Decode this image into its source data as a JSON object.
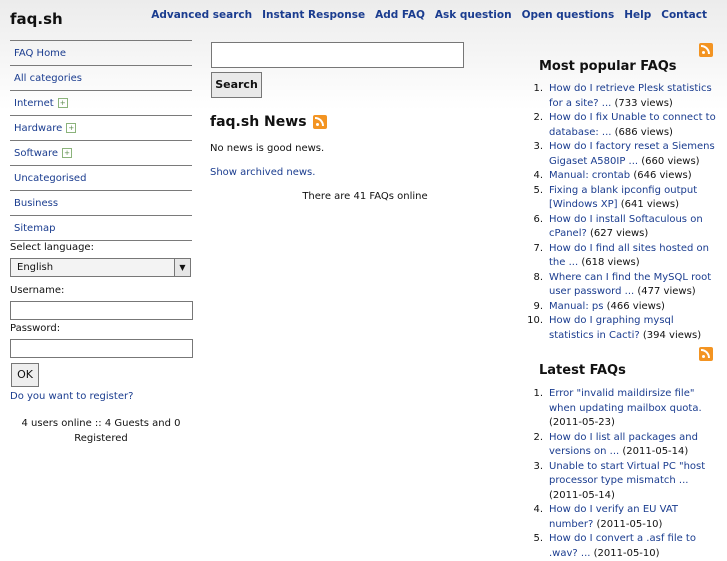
{
  "site": {
    "title": "faq.sh"
  },
  "topnav": [
    "Advanced search",
    "Instant Response",
    "Add FAQ",
    "Ask question",
    "Open questions",
    "Help",
    "Contact"
  ],
  "sidebar": {
    "items": [
      {
        "label": "FAQ Home",
        "expandable": false
      },
      {
        "label": "All categories",
        "expandable": false
      },
      {
        "label": "Internet",
        "expandable": true
      },
      {
        "label": "Hardware",
        "expandable": true
      },
      {
        "label": "Software",
        "expandable": true
      },
      {
        "label": "Uncategorised",
        "expandable": false
      },
      {
        "label": "Business",
        "expandable": false
      },
      {
        "label": "Sitemap",
        "expandable": false
      }
    ],
    "language_label": "Select language:",
    "language_value": "English",
    "username_label": "Username:",
    "password_label": "Password:",
    "ok_label": "OK",
    "register_link": "Do you want to register?",
    "online_text": "4 users online :: 4 Guests and 0 Registered"
  },
  "main": {
    "search_button": "Search",
    "news_title": "faq.sh News",
    "news_empty": "No news is good news.",
    "archived_link": "Show archived news.",
    "faqs_online": "There are 41 FAQs online"
  },
  "popular": {
    "title": "Most popular FAQs",
    "items": [
      {
        "link": "How do I retrieve Plesk statistics for a site? ...",
        "meta": "(733 views)"
      },
      {
        "link": "How do I fix Unable to connect to database: ...",
        "meta": "(686 views)"
      },
      {
        "link": "How do I factory reset a Siemens Gigaset A580IP ...",
        "meta": "(660 views)"
      },
      {
        "link": "Manual: crontab",
        "meta": "(646 views)"
      },
      {
        "link": "Fixing a blank ipconfig output [Windows XP]",
        "meta": "(641 views)"
      },
      {
        "link": "How do I install Softaculous on cPanel?",
        "meta": "(627 views)"
      },
      {
        "link": "How do I find all sites hosted on the ...",
        "meta": "(618 views)"
      },
      {
        "link": "Where can I find the MySQL root user password ...",
        "meta": "(477 views)"
      },
      {
        "link": "Manual: ps",
        "meta": "(466 views)"
      },
      {
        "link": "How do I graphing mysql statistics in Cacti?",
        "meta": "(394 views)"
      }
    ]
  },
  "latest": {
    "title": "Latest FAQs",
    "items": [
      {
        "link": "Error \"invalid maildirsize file\" when updating mailbox quota.",
        "meta": "(2011-05-23)"
      },
      {
        "link": "How do I list all packages and versions on ...",
        "meta": "(2011-05-14)"
      },
      {
        "link": "Unable to start Virtual PC \"host processor type mismatch ...",
        "meta": "(2011-05-14)"
      },
      {
        "link": "How do I verify an EU VAT number?",
        "meta": "(2011-05-10)"
      },
      {
        "link": "How do I convert a .asf file to .wav? ...",
        "meta": "(2011-05-10)"
      }
    ]
  }
}
